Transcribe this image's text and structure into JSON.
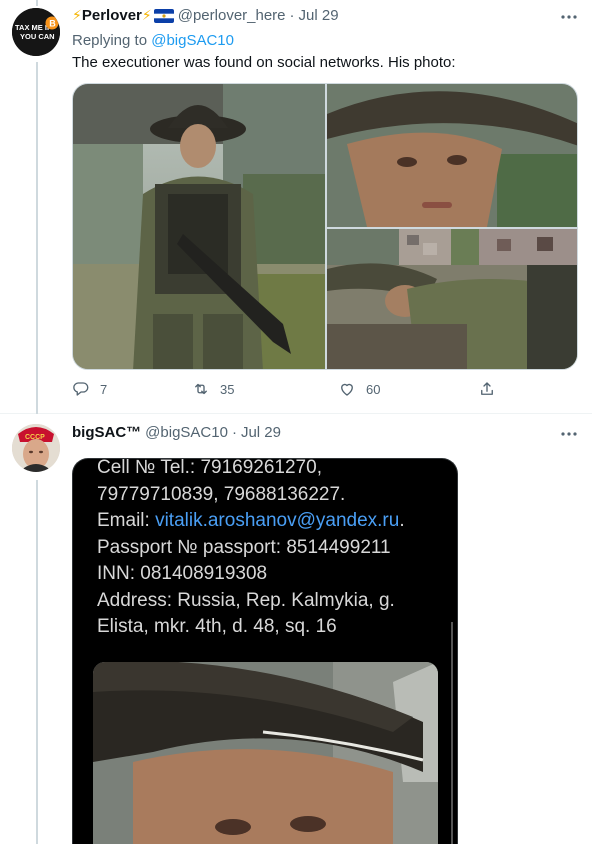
{
  "tweets": [
    {
      "display_name": "Perlover",
      "name_prefix_emoji": "⚡",
      "name_suffix_emoji": "⚡",
      "handle": "@perlover_here",
      "separator": "·",
      "date": "Jul 29",
      "avatar_text_top": "TAX ME IF",
      "avatar_text_bottom": "YOU CAN",
      "avatar_badge": "B",
      "replying_to_prefix": "Replying to ",
      "replying_to_handle": "@bigSAC10",
      "text": "The executioner was found on social networks. His photo:",
      "more_icon": "more-dots-icon",
      "actions": {
        "reply_count": "7",
        "retweet_count": "35",
        "like_count": "60"
      }
    },
    {
      "display_name": "bigSAC™",
      "handle": "@bigSAC10",
      "separator": "·",
      "date": "Jul 29",
      "more_icon": "more-dots-icon",
      "avatar_hat_text": "СССР"
    }
  ],
  "document": {
    "line1": "Cell № Tel.: 79169261270,",
    "line2": "79779710839, 79688136227.",
    "email_label": "Email: ",
    "email_value": "vitalik.aroshanov@yandex.ru",
    "email_end": ".",
    "line4": "Passport № passport: 8514499211",
    "line5": "INN: 081408919308",
    "line6": "Address: Russia, Rep. Kalmykia, g.",
    "line7": "Elista, mkr. 4th, d. 48, sq. 16"
  },
  "colors": {
    "link": "#1d9bf0",
    "secondary_text": "#536471",
    "thread_line": "#cfd9de",
    "email_link": "#4a9ff5"
  }
}
